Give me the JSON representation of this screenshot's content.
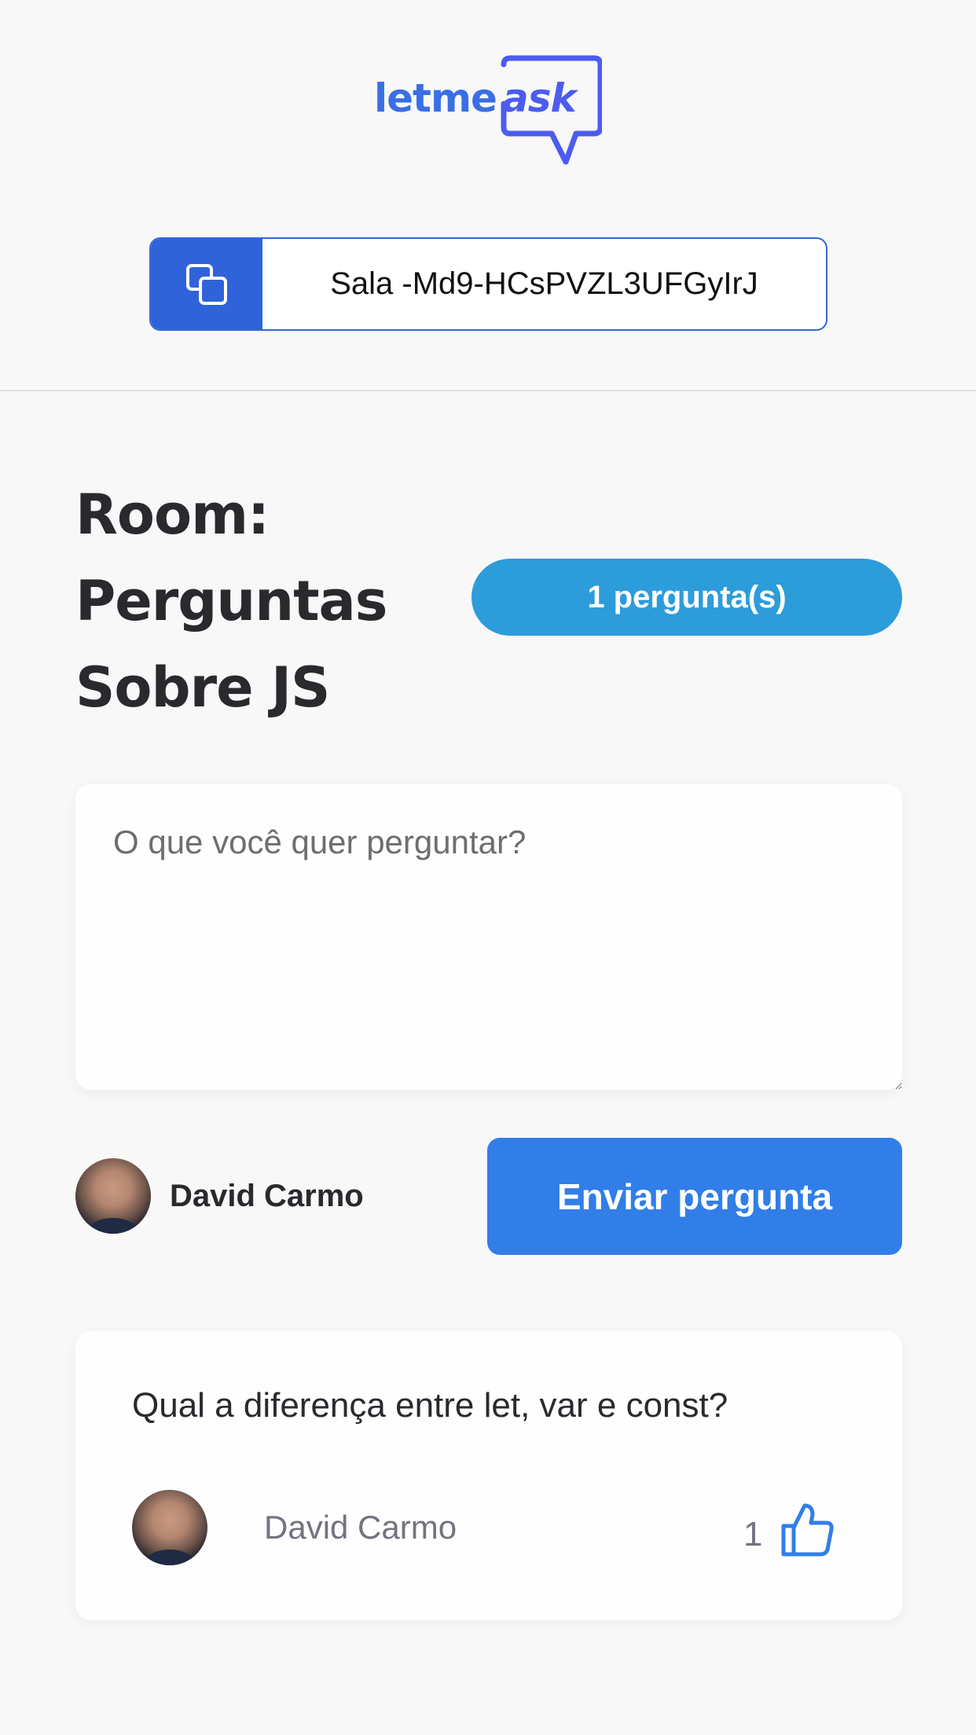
{
  "header": {
    "logo": {
      "part1": "letme",
      "part2": "ask"
    },
    "room_code": "Sala -Md9-HCsPVZL3UFGyIrJ"
  },
  "main": {
    "title": "Room: Perguntas Sobre JS",
    "question_count_badge": "1 pergunta(s)",
    "form": {
      "placeholder": "O que você quer perguntar?",
      "value": "",
      "user_name": "David Carmo",
      "submit_label": "Enviar pergunta"
    },
    "questions": [
      {
        "content": "Qual a diferença entre let, var e const?",
        "author": "David Carmo",
        "like_count": "1"
      }
    ]
  },
  "colors": {
    "brand": "#3a6fe4",
    "copy_button": "#3062d9",
    "badge": "#2d9cdb",
    "primary_button": "#317ee8",
    "background": "#f8f8f8"
  },
  "icons": [
    "copy-icon",
    "like-icon"
  ]
}
